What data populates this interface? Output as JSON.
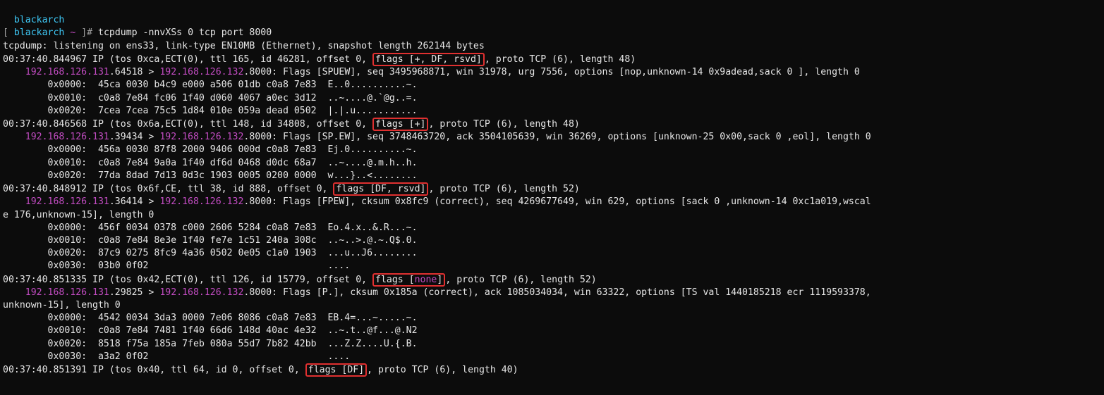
{
  "prevLine": "  blackarch",
  "prompt": {
    "host": "blackarch",
    "path": "~",
    "command": "tcpdump -nnvXSs 0 tcp port 8000"
  },
  "listening": "tcpdump: listening on ens33, link-type EN10MB (Ethernet), snapshot length 262144 bytes",
  "packets": [
    {
      "ipline_a": "00:37:40.844967 IP (tos 0xca,ECT(0), ttl 165, id 46281, offset 0, ",
      "flagsbox": "flags [+, DF, rsvd]",
      "ipline_b": ", proto TCP (6), length 48)",
      "srcip": "192.168.126.131",
      "srcport": ".64518 > ",
      "dstip": "192.168.126.132",
      "tcprest": ".8000: Flags [SPUEW], seq 3495968871, win 31978, urg 7556, options [nop,unknown-14 0x9adead,sack 0 ], length 0",
      "hex": [
        "        0x0000:  45ca 0030 b4c9 e000 a506 01db c0a8 7e83  E..0..........~.",
        "        0x0010:  c0a8 7e84 fc06 1f40 d060 4067 a0ec 3d12  ..~....@.`@g..=.",
        "        0x0020:  7cea 7cea 75c5 1d84 010e 059a dead 0502  |.|.u..........."
      ]
    },
    {
      "ipline_a": "00:37:40.846568 IP (tos 0x6a,ECT(0), ttl 148, id 34808, offset 0, ",
      "flagsbox": "flags [+]",
      "ipline_b": ", proto TCP (6), length 48)",
      "srcip": "192.168.126.131",
      "srcport": ".39434 > ",
      "dstip": "192.168.126.132",
      "tcprest": ".8000: Flags [SP.EW], seq 3748463720, ack 3504105639, win 36269, options [unknown-25 0x00,sack 0 ,eol], length 0",
      "hex": [
        "        0x0000:  456a 0030 87f8 2000 9406 000d c0a8 7e83  Ej.0..........~.",
        "        0x0010:  c0a8 7e84 9a0a 1f40 df6d 0468 d0dc 68a7  ..~....@.m.h..h.",
        "        0x0020:  77da 8dad 7d13 0d3c 1903 0005 0200 0000  w...}..<........"
      ]
    },
    {
      "ipline_a": "00:37:40.848912 IP (tos 0x6f,CE, ttl 38, id 888, offset 0, ",
      "flagsbox": "flags [DF, rsvd]",
      "ipline_b": ", proto TCP (6), length 52)",
      "srcip": "192.168.126.131",
      "srcport": ".36414 > ",
      "dstip": "192.168.126.132",
      "tcprest": ".8000: Flags [FPEW], cksum 0x8fc9 (correct), seq 4269677649, win 629, options [sack 0 ,unknown-14 0xc1a019,wscal",
      "tcprest2": "e 176,unknown-15], length 0",
      "hex": [
        "        0x0000:  456f 0034 0378 c000 2606 5284 c0a8 7e83  Eo.4.x..&.R...~.",
        "        0x0010:  c0a8 7e84 8e3e 1f40 fe7e 1c51 240a 308c  ..~..>.@.~.Q$.0.",
        "        0x0020:  87c9 0275 8fc9 4a36 0502 0e05 c1a0 1903  ...u..J6........",
        "        0x0030:  03b0 0f02                                ...."
      ]
    },
    {
      "ipline_a": "00:37:40.851335 IP (tos 0x42,ECT(0), ttl 126, id 15779, offset 0, ",
      "flags_inner": "none",
      "ipline_b": ", proto TCP (6), length 52)",
      "srcip": "192.168.126.131",
      "srcport": ".29825 > ",
      "dstip": "192.168.126.132",
      "tcprest": ".8000: Flags [P.], cksum 0x185a (correct), ack 1085034034, win 63322, options [TS val 1440185218 ecr 1119593378,",
      "tcprest2": "unknown-15], length 0",
      "hex": [
        "        0x0000:  4542 0034 3da3 0000 7e06 8086 c0a8 7e83  EB.4=...~.....~.",
        "        0x0010:  c0a8 7e84 7481 1f40 66d6 148d 40ac 4e32  ..~.t..@f...@.N2",
        "        0x0020:  8518 f75a 185a 7feb 080a 55d7 7b82 42bb  ...Z.Z....U.{.B.",
        "        0x0030:  a3a2 0f02                                ...."
      ]
    },
    {
      "ipline_a": "00:37:40.851391 IP (tos 0x40, ttl 64, id 0, offset 0, ",
      "flagsbox": "flags [DF]",
      "ipline_b": ", proto TCP (6), length 40)"
    }
  ]
}
